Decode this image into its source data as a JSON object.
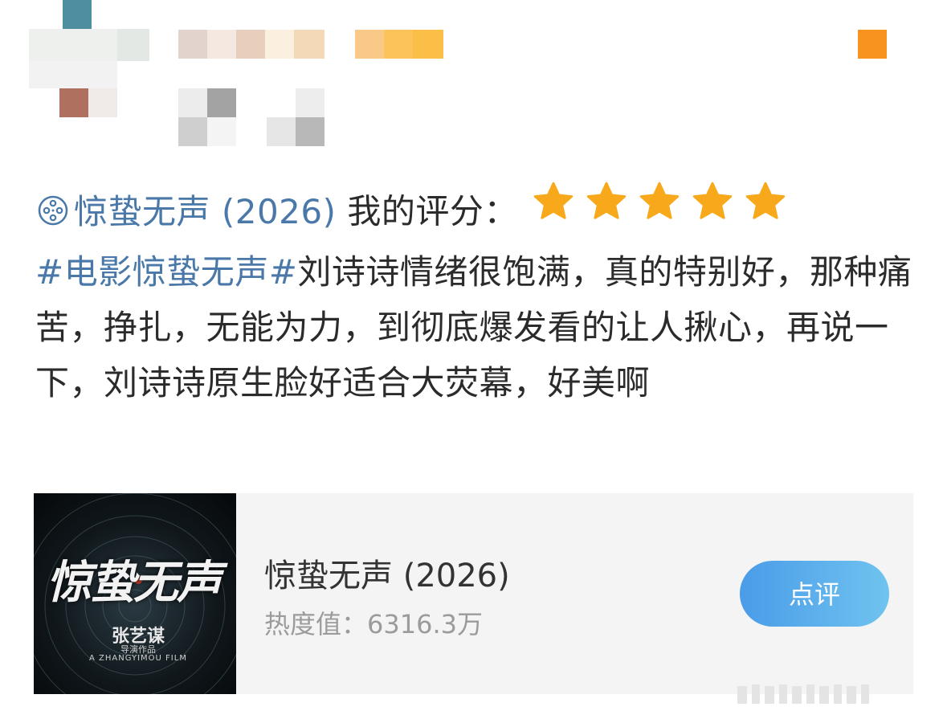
{
  "post": {
    "movie_line": "惊蛰无声 (2026)",
    "rating_label": "我的评分：",
    "rating_stars": 5,
    "rating_max": 5,
    "hashtag": "#电影惊蛰无声#",
    "body": "刘诗诗情绪很饱满，真的特别好，那种痛苦，挣扎，无能为力，到彻底爆发看的让人揪心，再说一下，刘诗诗原生脸好适合大荧幕，好美啊"
  },
  "card": {
    "title": "惊蛰无声 (2026)",
    "heat": "热度值：6316.3万",
    "review_button": "点评",
    "poster": {
      "title": "惊蛰无声",
      "director": "张艺谋",
      "director_sub": "导演作品",
      "english": "A ZHANGYIMOU FILM"
    }
  },
  "colors": {
    "link": "#4a78a8",
    "star": "#f8a91b",
    "button_gradient_start": "#4a9ce8",
    "button_gradient_end": "#6fc3ef",
    "card_bg": "#f4f4f4",
    "badge": "#f7931e"
  },
  "icons": {
    "movie": "film-reel-icon",
    "star": "star-icon"
  }
}
